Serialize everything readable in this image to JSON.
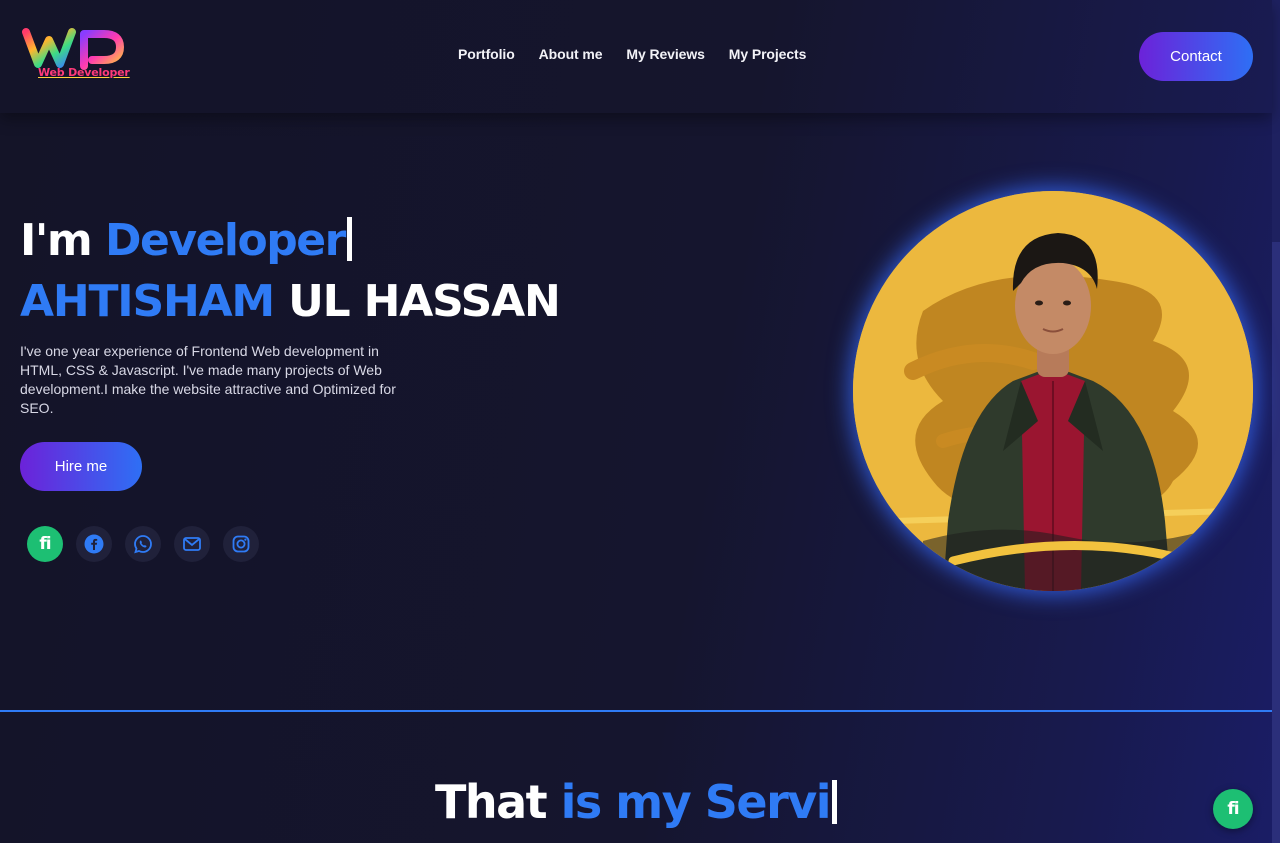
{
  "header": {
    "logo_letters": "WP",
    "logo_subtitle": "Web Developer",
    "nav": [
      {
        "label": "Portfolio"
      },
      {
        "label": "About me"
      },
      {
        "label": "My Reviews"
      },
      {
        "label": "My Projects"
      }
    ],
    "contact_label": "Contact"
  },
  "hero": {
    "intro_prefix": "I'm",
    "intro_typed": "Developer",
    "name_first": "AHTISHAM",
    "name_rest": "UL HASSAN",
    "description": "I've one year experience of Frontend Web development in HTML, CSS & Javascript. I've made many projects of Web development.I make the website attractive and Optimized for SEO.",
    "hire_label": "Hire me",
    "socials": [
      {
        "icon": "fiverr-icon",
        "label": "fi"
      },
      {
        "icon": "facebook-icon"
      },
      {
        "icon": "whatsapp-icon"
      },
      {
        "icon": "mail-icon"
      },
      {
        "icon": "instagram-icon"
      }
    ]
  },
  "services": {
    "title_white": "That",
    "title_accent": "is my Servi"
  },
  "floating": {
    "fiverr_label": "fi"
  },
  "colors": {
    "accent": "#2f7bf5",
    "button_gradient_start": "#6c22d9",
    "button_gradient_end": "#2e6ff5",
    "fiverr_green": "#1dbf73",
    "portrait_bg": "#ecb83e",
    "background": "#141428"
  }
}
